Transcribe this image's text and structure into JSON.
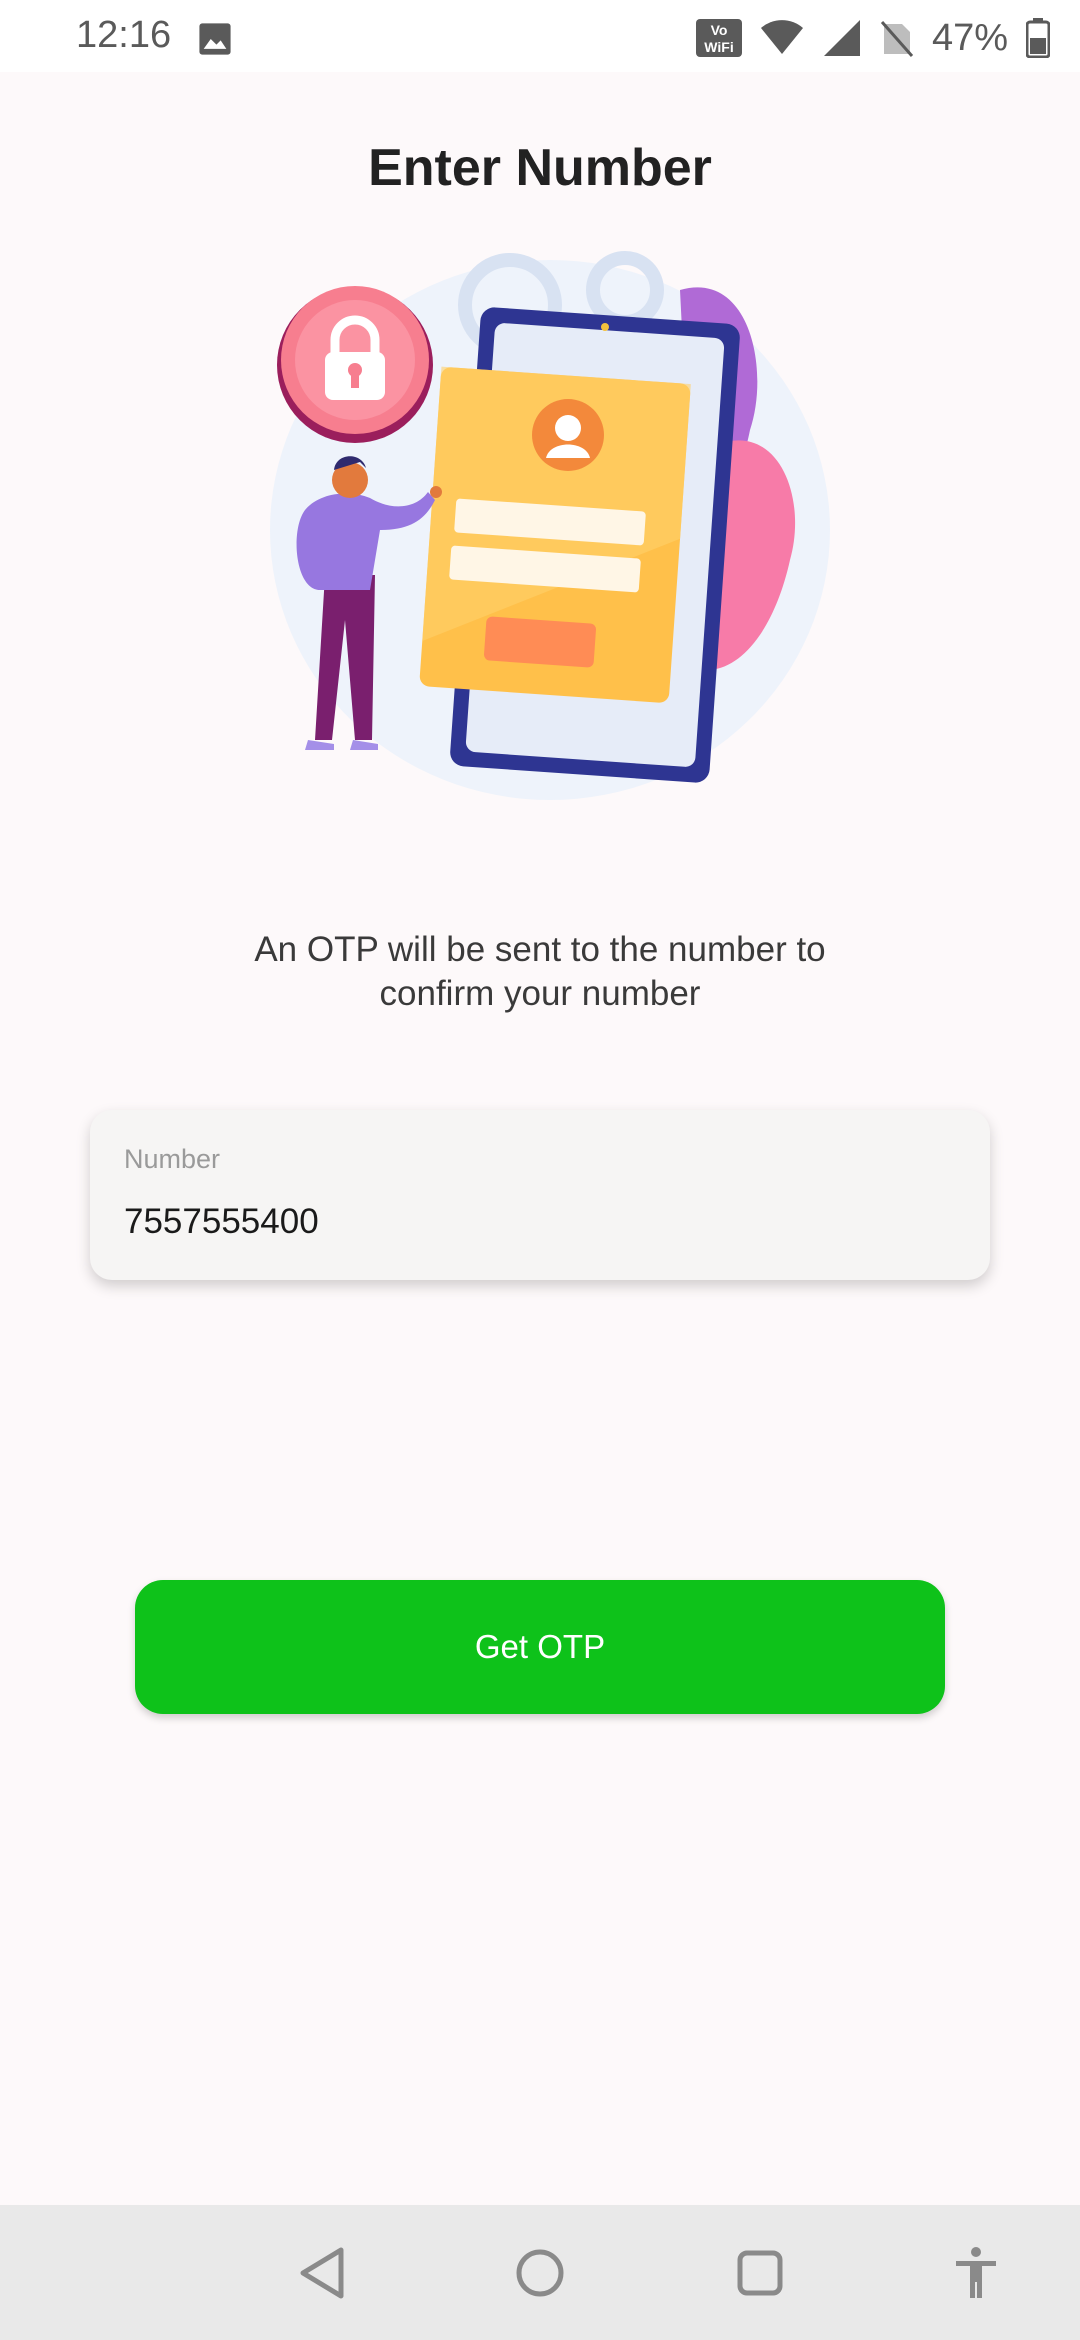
{
  "status_bar": {
    "time": "12:16",
    "battery_percent": "47%",
    "icons": [
      "gallery-icon",
      "vowifi-icon",
      "wifi-icon",
      "signal-icon",
      "no-sim-icon",
      "battery-icon"
    ]
  },
  "page": {
    "title": "Enter Number",
    "subtitle_line1": "An OTP will be sent to the number to",
    "subtitle_line2": "confirm your number"
  },
  "number_field": {
    "label": "Number",
    "value": "7557555400"
  },
  "actions": {
    "get_otp_label": "Get OTP"
  },
  "nav_bar": {
    "icons": [
      "back-icon",
      "home-icon",
      "recents-icon",
      "accessibility-icon"
    ]
  },
  "colors": {
    "accent": "#0ec21a",
    "background": "#fdf9fa",
    "card": "#f6f5f4"
  }
}
